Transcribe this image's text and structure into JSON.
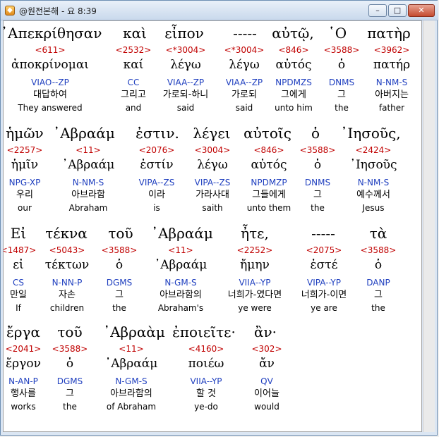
{
  "window": {
    "title": "@원전본해 - 요 8:39",
    "min": "–",
    "max": "□",
    "close": "✕"
  },
  "rows": [
    {
      "cols": [
        {
          "greek": "᾿Απεκρίθησαν",
          "num": "<611>",
          "lemma": "ἀποκρίνομαι",
          "parse": "VIAO--ZP",
          "korean": "대답하여",
          "english": "They answered"
        },
        {
          "greek": "καὶ",
          "num": "<2532>",
          "lemma": "καί",
          "parse": "CC",
          "korean": "그리고",
          "english": "and"
        },
        {
          "greek": "εἶπον",
          "num": "<*3004>",
          "lemma": "λέγω",
          "parse": "VIAA--ZP",
          "korean": "가로되-하니",
          "english": "said"
        },
        {
          "greek": "-----",
          "num": "<*3004>",
          "lemma": "λέγω",
          "parse": "VIAA--ZP",
          "korean": "가로되",
          "english": "said"
        },
        {
          "greek": "αὐτῷ,",
          "num": "<846>",
          "lemma": "αὐτός",
          "parse": "NPDMZS",
          "korean": "그에게",
          "english": "unto him"
        },
        {
          "greek": "῾Ο",
          "num": "<3588>",
          "lemma": "ὁ",
          "parse": "DNMS",
          "korean": "그",
          "english": "the"
        },
        {
          "greek": "πατὴρ",
          "num": "<3962>",
          "lemma": "πατήρ",
          "parse": "N-NM-S",
          "korean": "아버지는",
          "english": "father"
        }
      ]
    },
    {
      "cols": [
        {
          "greek": "ἡμῶν",
          "num": "<2257>",
          "lemma": "ἡμῖν",
          "parse": "NPG-XP",
          "korean": "우리",
          "english": "our"
        },
        {
          "greek": "᾿Αβραάμ",
          "num": "<11>",
          "lemma": "᾿Αβραάμ",
          "parse": "N-NM-S",
          "korean": "아브라함",
          "english": "Abraham"
        },
        {
          "greek": "ἐστιν.",
          "num": "<2076>",
          "lemma": "ἐστίν",
          "parse": "VIPA--ZS",
          "korean": "이라",
          "english": "is"
        },
        {
          "greek": "λέγει",
          "num": "<3004>",
          "lemma": "λέγω",
          "parse": "VIPA--ZS",
          "korean": "가라사대",
          "english": "saith"
        },
        {
          "greek": "αὐτοῖς",
          "num": "<846>",
          "lemma": "αὐτός",
          "parse": "NPDMZP",
          "korean": "그들에게",
          "english": "unto them"
        },
        {
          "greek": "ὁ",
          "num": "<3588>",
          "lemma": "ὁ",
          "parse": "DNMS",
          "korean": "그",
          "english": "the"
        },
        {
          "greek": "᾿Ιησοῦς,",
          "num": "<2424>",
          "lemma": "᾿Ιησοῦς",
          "parse": "N-NM-S",
          "korean": "예수께서",
          "english": "Jesus"
        }
      ]
    },
    {
      "cols": [
        {
          "greek": "Εἰ",
          "num": "<1487>",
          "lemma": "εἰ",
          "parse": "CS",
          "korean": "만일",
          "english": "If"
        },
        {
          "greek": "τέκνα",
          "num": "<5043>",
          "lemma": "τέκτων",
          "parse": "N-NN-P",
          "korean": "자손",
          "english": "children"
        },
        {
          "greek": "τοῦ",
          "num": "<3588>",
          "lemma": "ὁ",
          "parse": "DGMS",
          "korean": "그",
          "english": "the"
        },
        {
          "greek": "᾿Αβραάμ",
          "num": "<11>",
          "lemma": "᾿Αβραάμ",
          "parse": "N-GM-S",
          "korean": "아브라함의",
          "english": "Abraham's"
        },
        {
          "greek": "ἦτε,",
          "num": "<2252>",
          "lemma": "ἤμην",
          "parse": "VIIA--YP",
          "korean": "너희가-였다면",
          "english": "ye were"
        },
        {
          "greek": "-----",
          "num": "<2075>",
          "lemma": "ἐστέ",
          "parse": "VIPA--YP",
          "korean": "너희가-이면",
          "english": "ye are"
        },
        {
          "greek": "τὰ",
          "num": "<3588>",
          "lemma": "ὁ",
          "parse": "DANP",
          "korean": "그",
          "english": "the"
        }
      ]
    },
    {
      "cols": [
        {
          "greek": "ἔργα",
          "num": "<2041>",
          "lemma": "ἔργον",
          "parse": "N-AN-P",
          "korean": "행사를",
          "english": "works"
        },
        {
          "greek": "τοῦ",
          "num": "<3588>",
          "lemma": "ὁ",
          "parse": "DGMS",
          "korean": "그",
          "english": "the"
        },
        {
          "greek": "᾿Αβραὰμ",
          "num": "<11>",
          "lemma": "᾿Αβραάμ",
          "parse": "N-GM-S",
          "korean": "아브라함의",
          "english": "of Abraham"
        },
        {
          "greek": "ἐποιεῖτε·",
          "num": "<4160>",
          "lemma": "ποιέω",
          "parse": "VIIA--YP",
          "korean": "할 것",
          "english": "ye-do"
        },
        {
          "greek": "ἂν·",
          "num": "<302>",
          "lemma": "ἄν",
          "parse": "QV",
          "korean": "이어늘",
          "english": "would"
        }
      ]
    }
  ]
}
